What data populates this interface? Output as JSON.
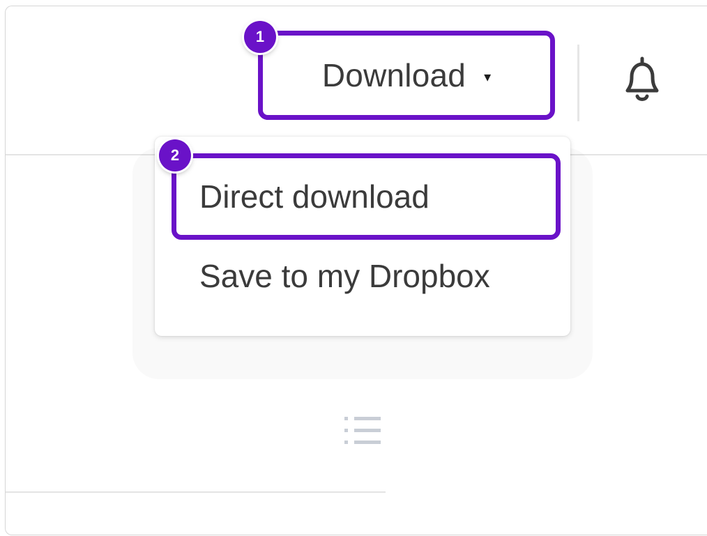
{
  "header": {
    "download_label": "Download",
    "download_caret": "▾",
    "bell_icon": "bell-icon"
  },
  "steps": {
    "step1": "1",
    "step2": "2"
  },
  "dropdown": {
    "items": [
      {
        "label": "Direct download",
        "highlighted": true
      },
      {
        "label": "Save to my Dropbox",
        "highlighted": false
      }
    ]
  },
  "body": {
    "list_icon": "list-icon"
  },
  "colors": {
    "accent": "#6a12c8",
    "text": "#3b3b3b",
    "divider": "#e4e4e4"
  }
}
